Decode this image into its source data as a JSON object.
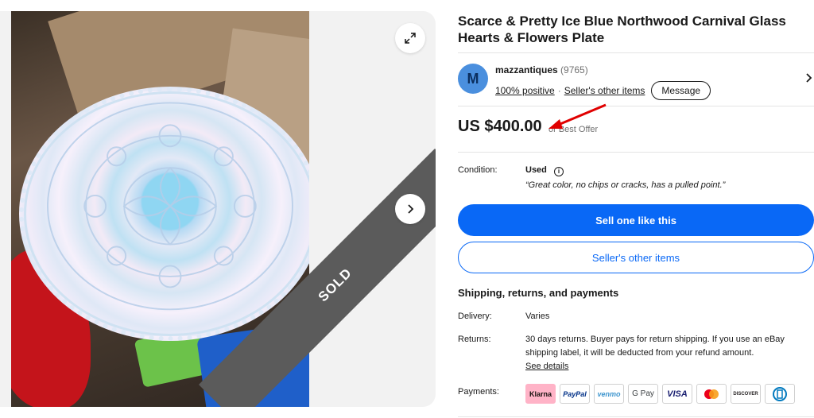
{
  "listing": {
    "title": "Scarce & Pretty Ice Blue Northwood Carnival Glass Hearts & Flowers Plate",
    "sold_label": "SOLD"
  },
  "seller": {
    "avatar_letter": "M",
    "name": "mazzantiques",
    "feedback_count": "(9765)",
    "positive_label": "100% positive",
    "other_items_link": "Seller's other items",
    "message_label": "Message"
  },
  "price": {
    "amount": "US $400.00",
    "best_offer": "or Best Offer"
  },
  "condition": {
    "label": "Condition:",
    "value": "Used",
    "description": "“Great color, no chips or cracks, has a pulled point.”"
  },
  "actions": {
    "sell_one": "Sell one like this",
    "other_items": "Seller's other items"
  },
  "shipping": {
    "section_title": "Shipping, returns, and payments",
    "delivery_label": "Delivery:",
    "delivery_value": "Varies",
    "returns_label": "Returns:",
    "returns_line1": "30 days returns. Buyer pays for return shipping. If you use an eBay",
    "returns_line2": "shipping label, it will be deducted from your refund amount.",
    "see_details": "See details",
    "payments_label": "Payments:"
  },
  "payment_methods": [
    "Klarna",
    "PayPal",
    "venmo",
    "G Pay",
    "VISA",
    "mastercard-icon",
    "DISCOVER",
    "diners-icon"
  ],
  "colors": {
    "primary_blue": "#0968f6",
    "annotation_red": "#e00000",
    "sold_ribbon": "#5b5b5b"
  }
}
